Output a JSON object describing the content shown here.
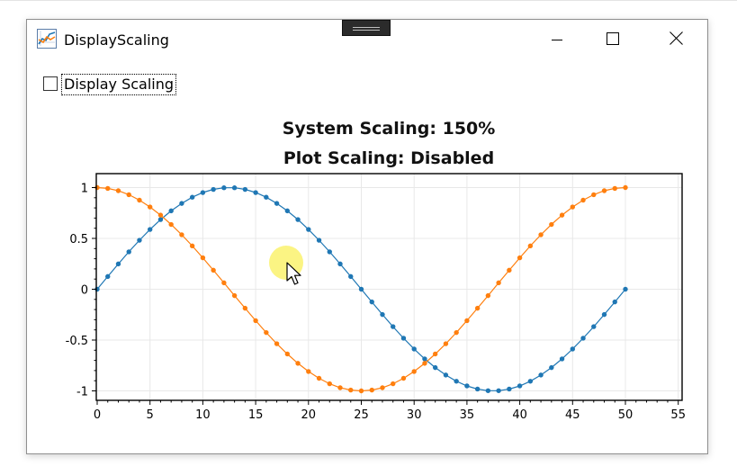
{
  "window": {
    "title": "DisplayScaling",
    "icon": "chart-app-icon"
  },
  "controls": {
    "checkbox_label": "Display Scaling",
    "checkbox_checked": false
  },
  "colors": {
    "series_cos": "#ff7f0e",
    "series_sin": "#1f77b4",
    "grid": "#e8e8e8",
    "cursor_highlight": "#f7ef6a"
  },
  "chart_data": {
    "type": "scatter",
    "title": [
      "System Scaling: 150%",
      "Plot Scaling: Disabled"
    ],
    "xlabel": "",
    "ylabel": "",
    "xlim": [
      0,
      55
    ],
    "ylim": [
      -1.1,
      1.1
    ],
    "xticks": [
      0,
      5,
      10,
      15,
      20,
      25,
      30,
      35,
      40,
      45,
      50,
      55
    ],
    "yticks": [
      1,
      0.5,
      0,
      -0.5,
      -1
    ],
    "ytick_labels": [
      "1",
      "0.5",
      "0",
      "-0.5",
      "-1"
    ],
    "grid": true,
    "series": [
      {
        "color": "#1f77b4",
        "x": [
          0,
          1,
          2,
          3,
          4,
          5,
          6,
          7,
          8,
          9,
          10,
          11,
          12,
          13,
          14,
          15,
          16,
          17,
          18,
          19,
          20,
          21,
          22,
          23,
          24,
          25,
          26,
          27,
          28,
          29,
          30,
          31,
          32,
          33,
          34,
          35,
          36,
          37,
          38,
          39,
          40,
          41,
          42,
          43,
          44,
          45,
          46,
          47,
          48,
          49,
          50
        ],
        "y": [
          0,
          0.125,
          0.249,
          0.368,
          0.482,
          0.588,
          0.685,
          0.771,
          0.844,
          0.905,
          0.951,
          0.982,
          0.998,
          0.998,
          0.982,
          0.951,
          0.905,
          0.844,
          0.771,
          0.685,
          0.588,
          0.482,
          0.368,
          0.249,
          0.125,
          0,
          -0.125,
          -0.249,
          -0.368,
          -0.482,
          -0.588,
          -0.685,
          -0.771,
          -0.844,
          -0.905,
          -0.951,
          -0.982,
          -0.998,
          -0.998,
          -0.982,
          -0.951,
          -0.905,
          -0.844,
          -0.771,
          -0.685,
          -0.588,
          -0.482,
          -0.368,
          -0.249,
          -0.125,
          0
        ]
      },
      {
        "color": "#ff7f0e",
        "x": [
          0,
          1,
          2,
          3,
          4,
          5,
          6,
          7,
          8,
          9,
          10,
          11,
          12,
          13,
          14,
          15,
          16,
          17,
          18,
          19,
          20,
          21,
          22,
          23,
          24,
          25,
          26,
          27,
          28,
          29,
          30,
          31,
          32,
          33,
          34,
          35,
          36,
          37,
          38,
          39,
          40,
          41,
          42,
          43,
          44,
          45,
          46,
          47,
          48,
          49,
          50
        ],
        "y": [
          1,
          0.992,
          0.969,
          0.93,
          0.876,
          0.809,
          0.729,
          0.637,
          0.536,
          0.426,
          0.309,
          0.187,
          0.063,
          -0.063,
          -0.187,
          -0.309,
          -0.426,
          -0.536,
          -0.637,
          -0.729,
          -0.809,
          -0.876,
          -0.93,
          -0.969,
          -0.992,
          -1,
          -0.992,
          -0.969,
          -0.93,
          -0.876,
          -0.809,
          -0.729,
          -0.637,
          -0.536,
          -0.426,
          -0.309,
          -0.187,
          -0.063,
          0.063,
          0.187,
          0.309,
          0.426,
          0.536,
          0.637,
          0.729,
          0.809,
          0.876,
          0.93,
          0.969,
          0.992,
          1
        ]
      }
    ]
  }
}
